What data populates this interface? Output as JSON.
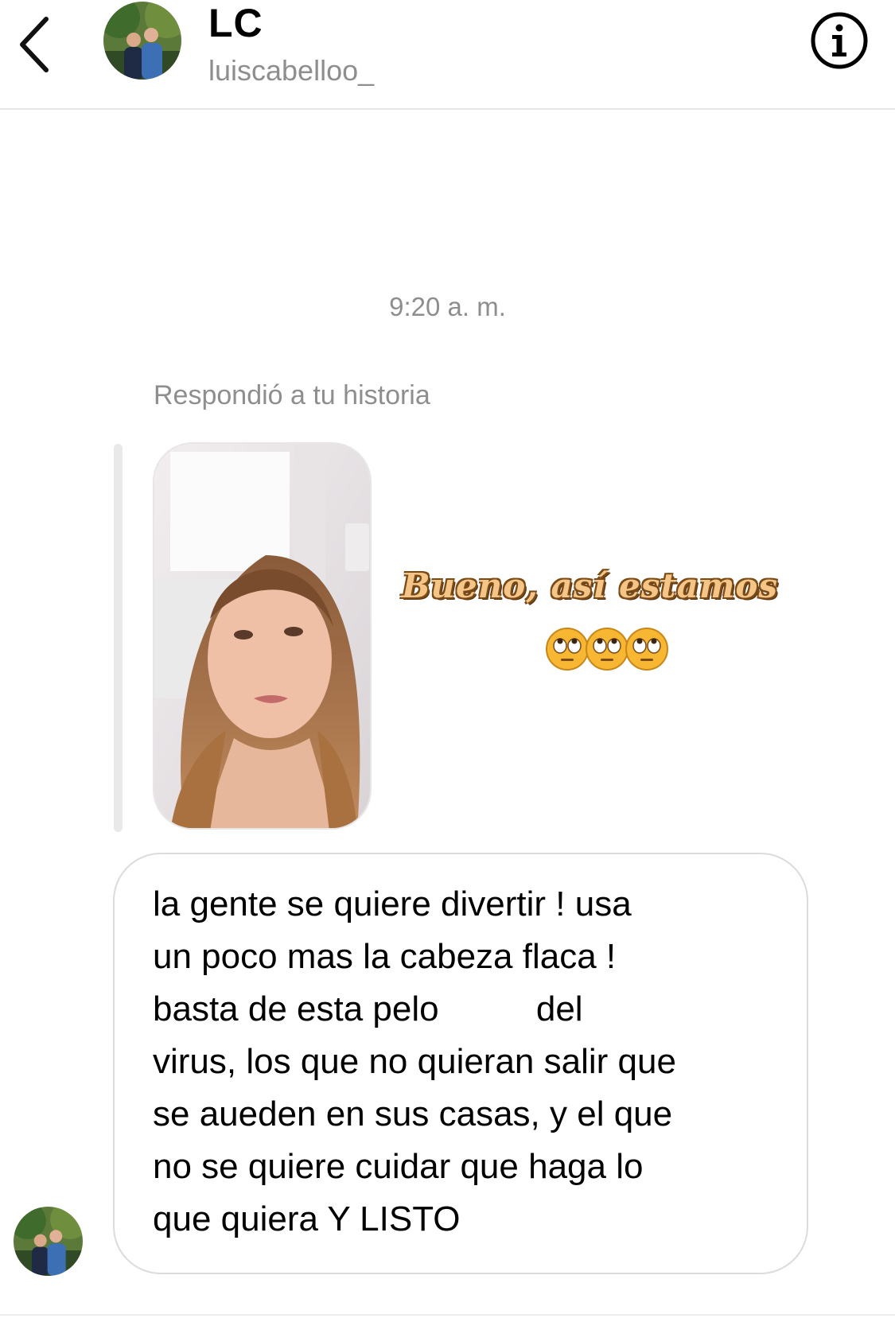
{
  "header": {
    "name": "LC",
    "username": "luiscabelloo_"
  },
  "thread": {
    "timestamp": "9:20 a. m.",
    "reply_label": "Respondió a tu historia",
    "story": {
      "caption": "Bueno, así estamos",
      "emoji": "rolling-eyes-emoji",
      "emoji_count": 3
    },
    "message_lines": [
      "la gente se quiere divertir ! usa",
      "un poco mas la cabeza flaca !",
      "basta de esta pelo          del",
      "virus, los que no quieran salir que",
      "se aueden en sus casas, y el que",
      "no se quiere cuidar que haga lo",
      "que quiera Y LISTO"
    ]
  }
}
